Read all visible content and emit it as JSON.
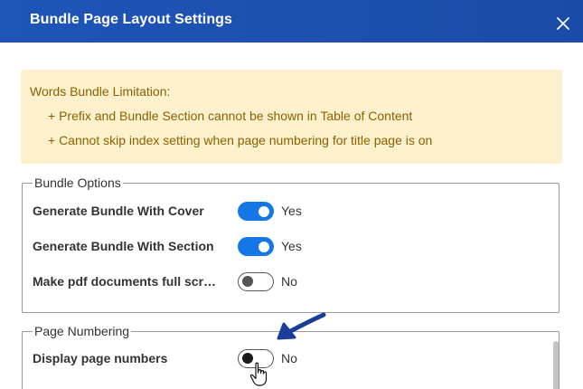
{
  "dialog": {
    "title": "Bundle Page Layout Settings",
    "close_icon": "close-icon"
  },
  "warning": {
    "heading": "Words Bundle Limitation:",
    "items": [
      "+ Prefix and Bundle Section cannot be shown in Table of Content",
      "+ Cannot skip index setting when page numbering for title page is on"
    ]
  },
  "bundle_options": {
    "legend": "Bundle Options",
    "rows": [
      {
        "label": "Generate Bundle With Cover",
        "state": "Yes",
        "on": true
      },
      {
        "label": "Generate Bundle With Section",
        "state": "Yes",
        "on": true
      },
      {
        "label": "Make pdf documents full screen",
        "state": "No",
        "on": false
      }
    ]
  },
  "page_numbering": {
    "legend": "Page Numbering",
    "rows": [
      {
        "label": "Display page numbers",
        "state": "No",
        "on": false
      }
    ]
  },
  "colors": {
    "titlebar": "#1f55b8",
    "toggle_on": "#1576e8",
    "warning_bg": "#fdf0cc",
    "warning_text": "#8a6100",
    "annotation_arrow": "#1a3d9a"
  }
}
